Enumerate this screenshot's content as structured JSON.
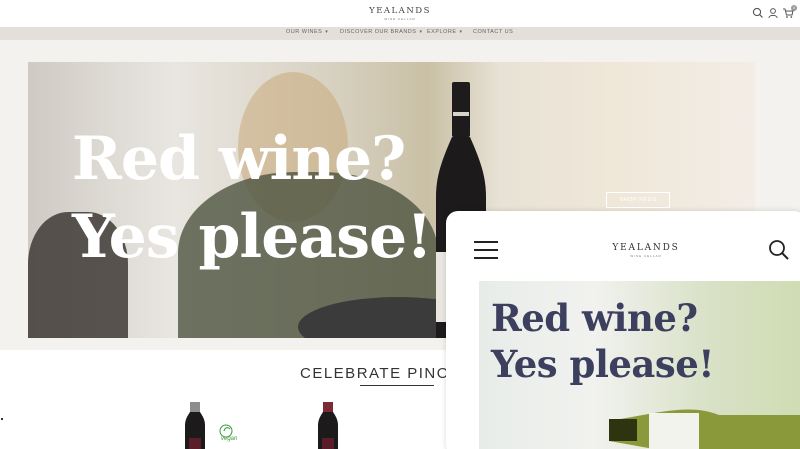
{
  "header": {
    "logo_main": "YEALANDS",
    "logo_sub": "WINE CELLAR",
    "icons": [
      "search-icon",
      "user-icon",
      "cart-icon"
    ],
    "cart_count": "0"
  },
  "nav": {
    "items": [
      {
        "label": "OUR WINES",
        "has_dropdown": true
      },
      {
        "label": "DISCOVER OUR BRANDS",
        "has_dropdown": true
      },
      {
        "label": "EXPLORE",
        "has_dropdown": true
      },
      {
        "label": "CONTACT US",
        "has_dropdown": false
      }
    ],
    "chevron": "▾"
  },
  "hero": {
    "line1": "Red wine?",
    "line2": "Yes please!",
    "cta": "SHOP REDS"
  },
  "section": {
    "title": "CELEBRATE PINOT"
  },
  "vegan_label": "vegan",
  "tablet": {
    "logo_main": "YEALANDS",
    "logo_sub": "WINE CELLAR",
    "hero_line1": "Red wine?",
    "hero_line2": "Yes please!"
  },
  "colors": {
    "nav_bg": "#e4e0d9",
    "banner_bg": "#f4f2ee",
    "tablet_hero_text": "#3c3f5e"
  }
}
